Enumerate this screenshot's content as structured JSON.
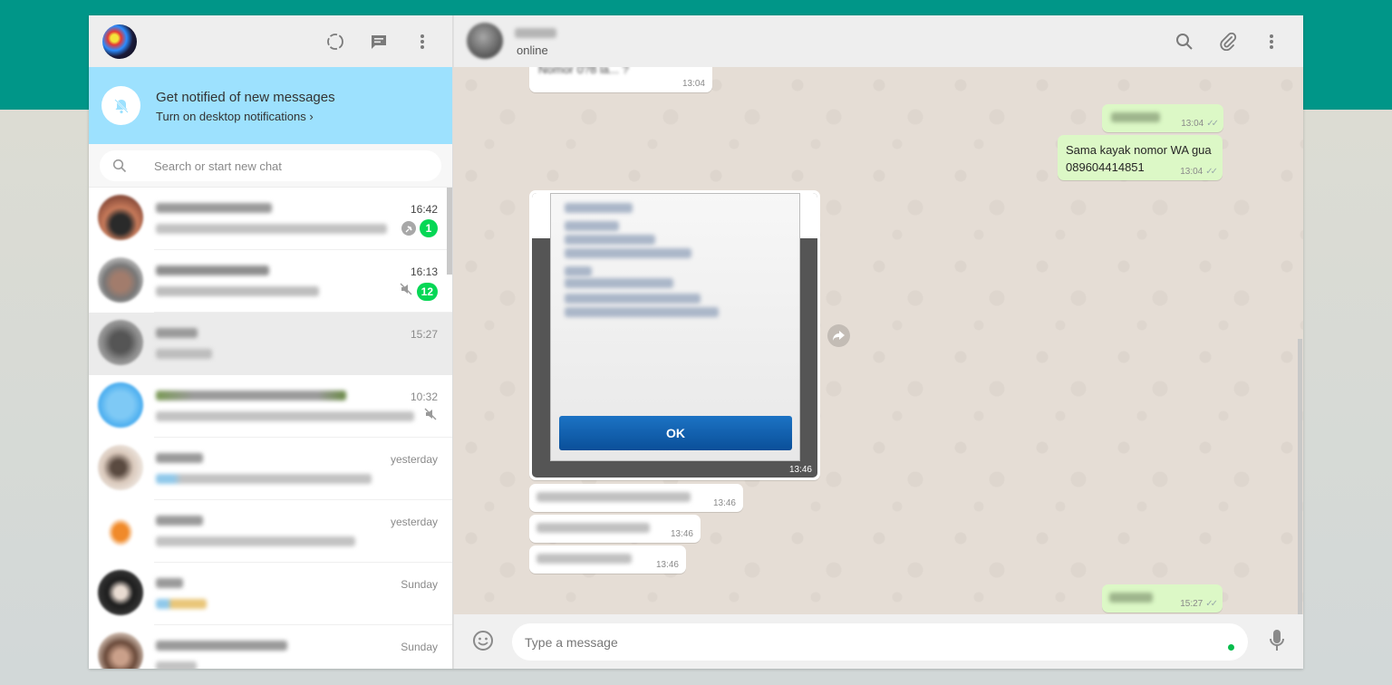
{
  "colors": {
    "teal": "#009688",
    "badge_green": "#06d755",
    "notif_bg": "#9de1fe",
    "outgoing_bubble": "#dcf8c6",
    "ok_button": "#0a4f99"
  },
  "sidebar": {
    "header_icons": [
      "status-icon",
      "new-chat-icon",
      "menu-icon"
    ],
    "notification": {
      "title": "Get notified of new messages",
      "link": "Turn on desktop notifications ›"
    },
    "search": {
      "placeholder": "Search or start new chat"
    },
    "chats": [
      {
        "time": "16:42",
        "unread": "1",
        "pinned": true,
        "muted": false
      },
      {
        "time": "16:13",
        "unread": "12",
        "pinned": false,
        "muted": true
      },
      {
        "time": "15:27",
        "unread": "",
        "active": true
      },
      {
        "time": "10:32",
        "unread": "",
        "muted": true
      },
      {
        "time": "yesterday",
        "unread": ""
      },
      {
        "time": "yesterday",
        "unread": ""
      },
      {
        "time": "Sunday",
        "unread": ""
      },
      {
        "time": "Sunday",
        "unread": ""
      }
    ]
  },
  "conversation": {
    "status": "online",
    "header_icons": [
      "search-icon",
      "attach-icon",
      "menu-icon"
    ],
    "messages": [
      {
        "dir": "in",
        "text": "Nomor 0?8 la... ?",
        "time": "13:04"
      },
      {
        "dir": "out",
        "text": "",
        "time": "13:04"
      },
      {
        "dir": "out",
        "text_line1": "Sama kayak nomor WA gua",
        "text_line2": "089604414851",
        "time": "13:04"
      },
      {
        "dir": "in",
        "type": "image",
        "image_button": "OK",
        "time": "13:46"
      },
      {
        "dir": "in",
        "text": "",
        "time": "13:46"
      },
      {
        "dir": "in",
        "text": "",
        "time": "13:46"
      },
      {
        "dir": "in",
        "text": "",
        "time": "13:46"
      },
      {
        "dir": "out",
        "text": "",
        "time": "15:27"
      }
    ],
    "composer": {
      "placeholder": "Type a message"
    }
  }
}
